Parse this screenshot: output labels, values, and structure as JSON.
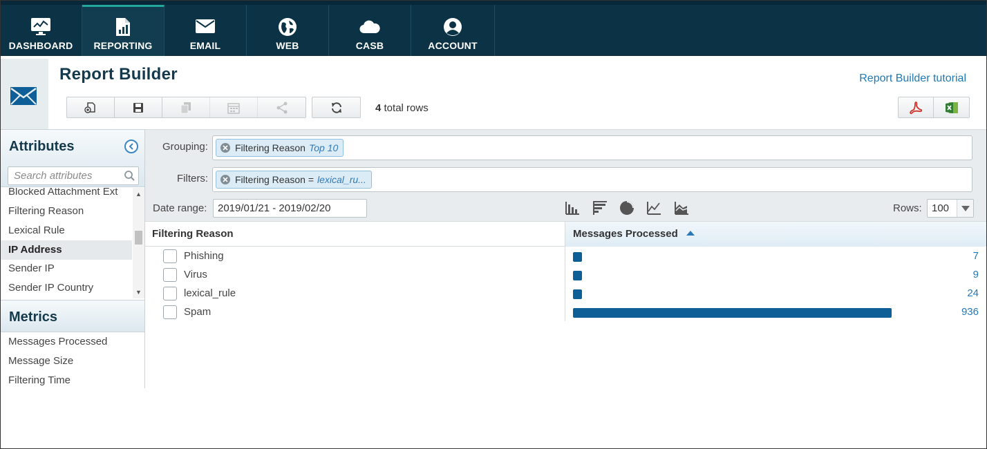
{
  "nav": {
    "tabs": [
      {
        "label": "DASHBOARD",
        "icon": "monitor-icon",
        "active": false
      },
      {
        "label": "REPORTING",
        "icon": "report-icon",
        "active": true
      },
      {
        "label": "EMAIL",
        "icon": "envelope-icon",
        "active": false
      },
      {
        "label": "WEB",
        "icon": "globe-icon",
        "active": false
      },
      {
        "label": "CASB",
        "icon": "cloud-icon",
        "active": false
      },
      {
        "label": "ACCOUNT",
        "icon": "user-circle-icon",
        "active": false
      }
    ]
  },
  "header": {
    "title": "Report Builder",
    "tutorial_link": "Report Builder tutorial",
    "total_rows_count": "4",
    "total_rows_label": "total rows",
    "toolbar_icons": [
      "new-report-icon",
      "save-icon",
      "copy-icon",
      "schedule-icon",
      "share-icon",
      "refresh-icon"
    ],
    "export_icons": [
      "pdf-icon",
      "excel-icon"
    ]
  },
  "sidebar": {
    "attributes_title": "Attributes",
    "search_placeholder": "Search attributes",
    "attributes": [
      {
        "label": "Blocked Attachment Ext",
        "selected": false
      },
      {
        "label": "Filtering Reason",
        "selected": false
      },
      {
        "label": "Lexical Rule",
        "selected": false
      },
      {
        "label": "IP Address",
        "selected": true
      },
      {
        "label": "Sender IP",
        "selected": false
      },
      {
        "label": "Sender IP Country",
        "selected": false
      }
    ],
    "metrics_title": "Metrics",
    "metrics": [
      "Messages Processed",
      "Message Size",
      "Filtering Time"
    ]
  },
  "controls": {
    "grouping_label": "Grouping:",
    "grouping_chip": {
      "name": "Filtering Reason",
      "qualifier": "Top 10"
    },
    "filters_label": "Filters:",
    "filter_chip": {
      "name": "Filtering Reason =",
      "qualifier": "lexical_ru..."
    },
    "date_label": "Date range:",
    "date_value": "2019/01/21 - 2019/02/20",
    "chart_icons": [
      "bar-chart-icon",
      "horizontal-bar-chart-icon",
      "pie-chart-icon",
      "line-chart-icon",
      "area-chart-icon"
    ],
    "rows_label": "Rows:",
    "rows_value": "100"
  },
  "table": {
    "col1_header": "Filtering Reason",
    "col2_header": "Messages Processed",
    "max_value": 936,
    "bar_color": "#0e5f97",
    "rows": [
      {
        "label": "Phishing",
        "value": "7",
        "num": 7
      },
      {
        "label": "Virus",
        "value": "9",
        "num": 9
      },
      {
        "label": "lexical_rule",
        "value": "24",
        "num": 24
      },
      {
        "label": "Spam",
        "value": "936",
        "num": 936
      }
    ]
  }
}
